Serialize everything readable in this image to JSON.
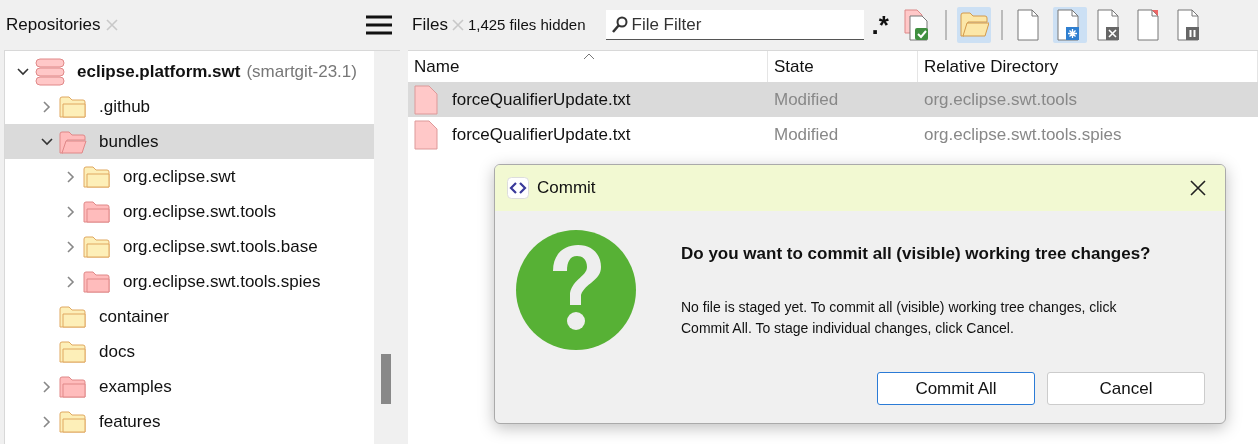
{
  "repositories": {
    "title": "Repositories",
    "tree": [
      {
        "name": "eclipse.platform.swt",
        "branch": "(smartgit-23.1)",
        "kind": "repository",
        "expanded": true,
        "selected": false,
        "color": "#ffc8c8",
        "children": [
          {
            "name": ".github",
            "kind": "folder",
            "expanded": false,
            "selected": false,
            "color": "#fdefb8"
          },
          {
            "name": "bundles",
            "kind": "folder",
            "expanded": true,
            "selected": true,
            "color": "#ffbcbc",
            "children": [
              {
                "name": "org.eclipse.swt",
                "kind": "folder",
                "expanded": false,
                "selected": false,
                "color": "#fdefb8"
              },
              {
                "name": "org.eclipse.swt.tools",
                "kind": "folder",
                "expanded": false,
                "selected": false,
                "color": "#ffbcbc"
              },
              {
                "name": "org.eclipse.swt.tools.base",
                "kind": "folder",
                "expanded": false,
                "selected": false,
                "color": "#fdefb8"
              },
              {
                "name": "org.eclipse.swt.tools.spies",
                "kind": "folder",
                "expanded": false,
                "selected": false,
                "color": "#ffbcbc"
              }
            ]
          },
          {
            "name": "container",
            "kind": "folder",
            "selected": false,
            "color": "#fdefb8"
          },
          {
            "name": "docs",
            "kind": "folder",
            "selected": false,
            "color": "#fdefb8"
          },
          {
            "name": "examples",
            "kind": "folder",
            "expanded": false,
            "selected": false,
            "color": "#ffbcbc"
          },
          {
            "name": "features",
            "kind": "folder",
            "expanded": false,
            "selected": false,
            "color": "#fdefb8"
          }
        ]
      }
    ]
  },
  "files": {
    "title": "Files",
    "hidden_count": "1,425 files hidden",
    "filter": {
      "placeholder": "File Filter"
    },
    "regex": ".*",
    "toolbar": [
      {
        "kind": "commit",
        "pressed": false
      },
      {
        "kind": "separator"
      },
      {
        "kind": "folder",
        "pressed": true
      },
      {
        "kind": "separator"
      },
      {
        "kind": "file",
        "pressed": false
      },
      {
        "kind": "file-new",
        "pressed": true
      },
      {
        "kind": "file-remove",
        "pressed": false
      },
      {
        "kind": "file-modified",
        "pressed": false
      },
      {
        "kind": "file-pause",
        "pressed": false
      }
    ],
    "columns": [
      "Name",
      "State",
      "Relative Directory"
    ],
    "rows": [
      {
        "name": "forceQualifierUpdate.txt",
        "state": "Modified",
        "directory": "org.eclipse.swt.tools",
        "selected": true
      },
      {
        "name": "forceQualifierUpdate.txt",
        "state": "Modified",
        "directory": "org.eclipse.swt.tools.spies",
        "selected": false
      }
    ]
  },
  "dialog": {
    "title": "Commit",
    "heading": "Do you want to commit all (visible) working tree changes?",
    "message": "No file is staged yet. To commit all (visible) working tree changes, click Commit All. To stage individual changes, click Cancel.",
    "buttons": [
      {
        "label": "Commit All",
        "default": true
      },
      {
        "label": "Cancel",
        "default": false
      }
    ]
  }
}
